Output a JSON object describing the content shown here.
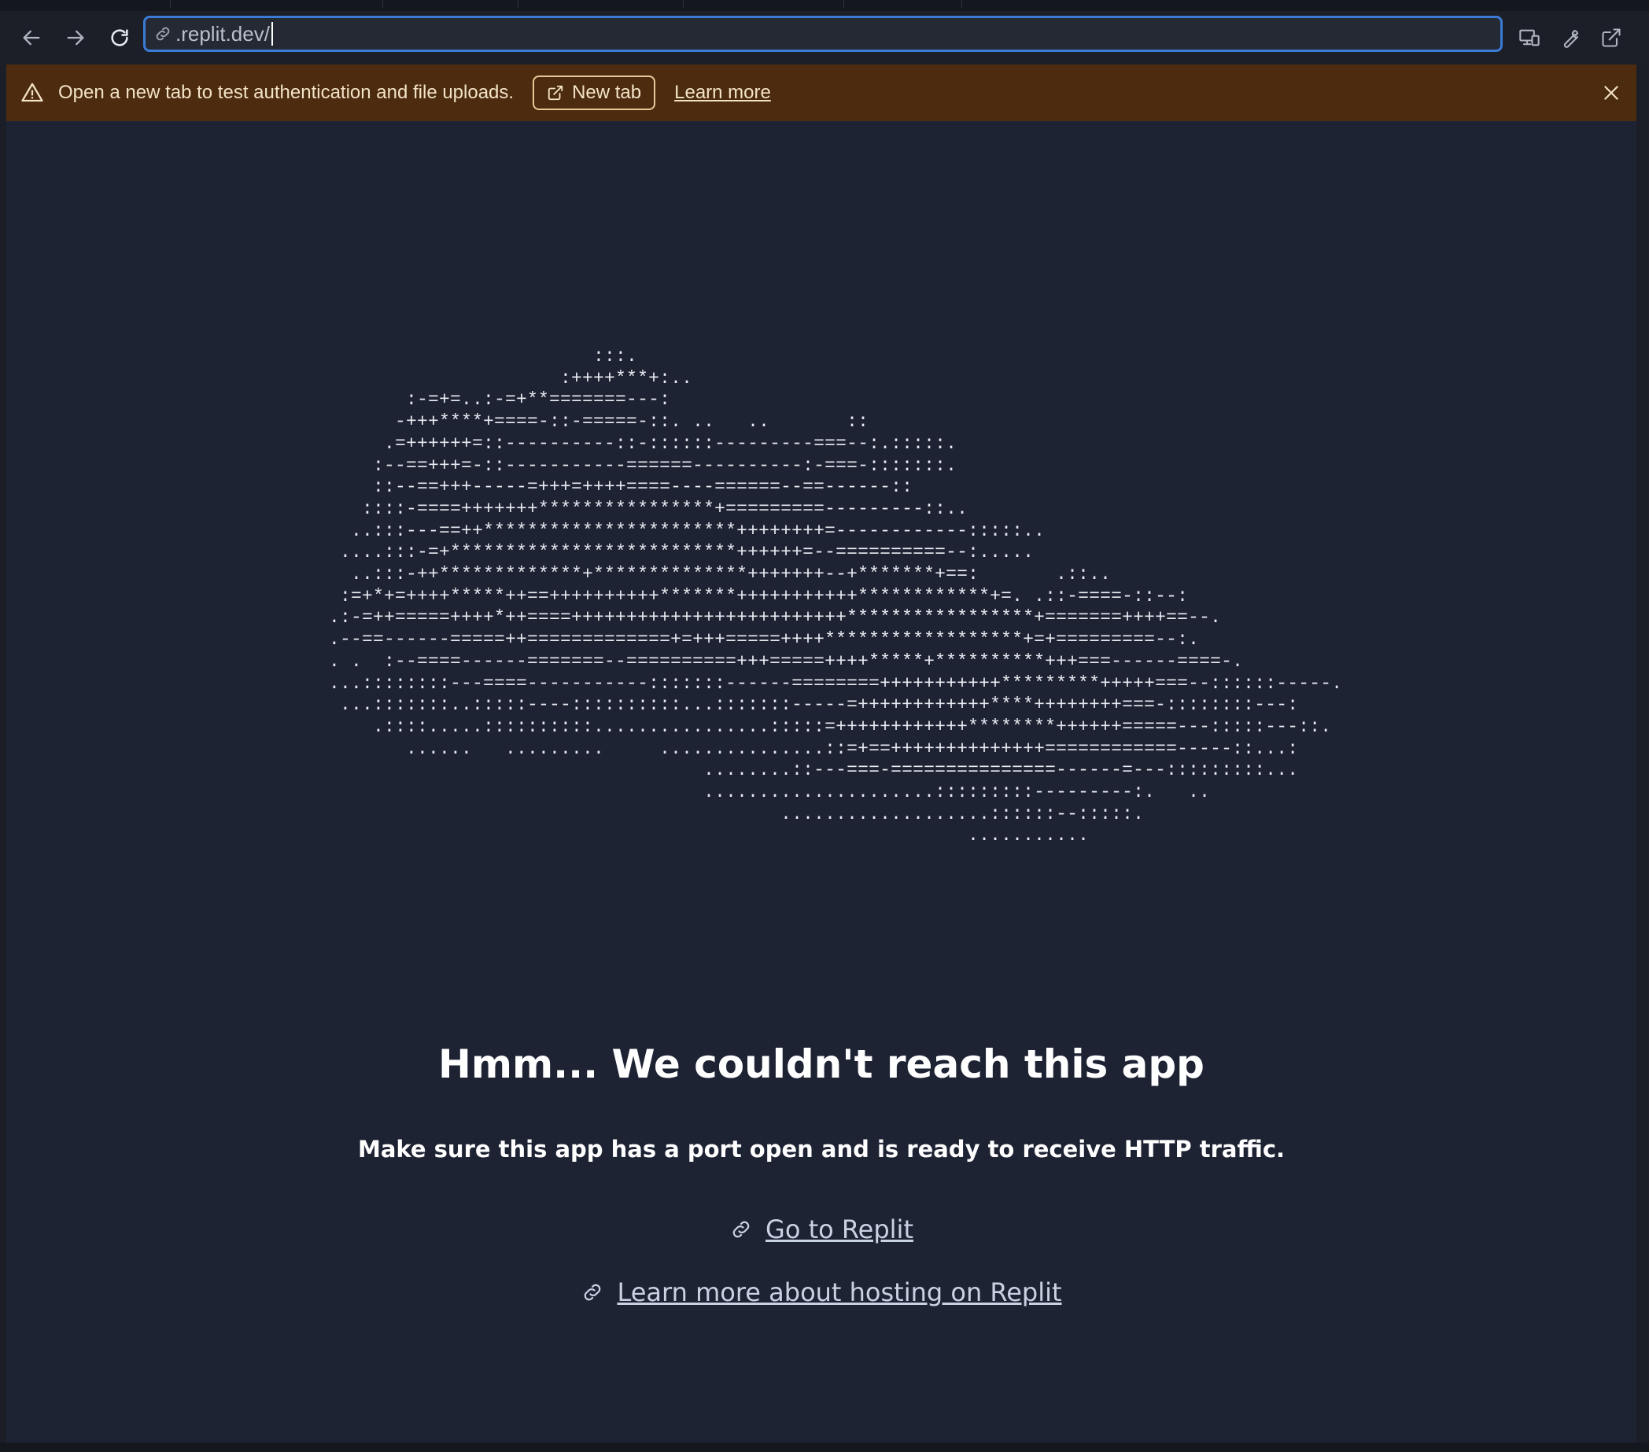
{
  "browser": {
    "url": ".replit.dev/",
    "nav": {
      "back_icon": "arrow-left-icon",
      "forward_icon": "arrow-right-icon",
      "reload_icon": "reload-icon"
    },
    "right_icons": [
      "devices-icon",
      "wrench-icon",
      "external-link-icon"
    ]
  },
  "banner": {
    "message": "Open a new tab to test authentication and file uploads.",
    "new_tab_label": "New tab",
    "learn_more_label": "Learn more",
    "colors": {
      "background": "#4c2b0e",
      "text": "#f3e3c8"
    }
  },
  "main": {
    "ascii_art": [
      "                        :::.",
      "                     :++++***+:..",
      "       :-=+=..:-=+**=======---:",
      "      -+++****+====-::-=====-::. ..   ..       ::",
      "     .=++++++=::----------::-::::::---------===--:.:::::.",
      "    :--==+++=-::-----------======----------:-===-:::::::.",
      "    ::--==+++-----=+++=++++====----======--==------::",
      "   ::::-====+++++++****************+=========---------::..",
      "  ..:::---==++***********************++++++++=------------:::::..",
      " ....:::-=+**************************++++++=--==========--:.....",
      "  ..:::-++*************+**************+++++++--+*******+==:       .::..",
      " :=+*+=++++*****++==++++++++++*******+++++++++++************+=. .::-====-::--:",
      ".:-=++=====++++*++====+++++++++++++++++++++++++*****************+=======++++==--.",
      ".--==------=====++=============+=+++=====++++******************+=+=========--:.",
      ". .  :--====------=======--==========+++=====++++*****+**********+++===------====-.",
      "...::::::::---====-----------:::::::------========+++++++++++*********+++++===--::::::-----.",
      " ...:::::::..:::::----::::::::::...:::::::-----=++++++++++++****++++++++===-::::::::---:",
      "    .::::.....::::::::::................:::::=++++++++++++********++++++=====---:::::---::.",
      "       ......   .........     ...............::=+==++++++++++++++============-----::...:",
      "                                  ........::---===-===============------=---:::::::::...",
      "                                  .....................:::::::::---------:.   ..",
      "                                         ...................::::::--:::::.",
      "                                                          ..........."
    ],
    "headline": "Hmm... We couldn't reach this app",
    "subtext": "Make sure this app has a port open and is ready to receive HTTP traffic.",
    "links": [
      {
        "label": "Go to Replit",
        "icon": "link-icon"
      },
      {
        "label": "Learn more about hosting on Replit",
        "icon": "link-icon"
      }
    ],
    "colors": {
      "background": "#1e2334",
      "text": "#ffffff",
      "link": "#c9d2e3"
    }
  }
}
